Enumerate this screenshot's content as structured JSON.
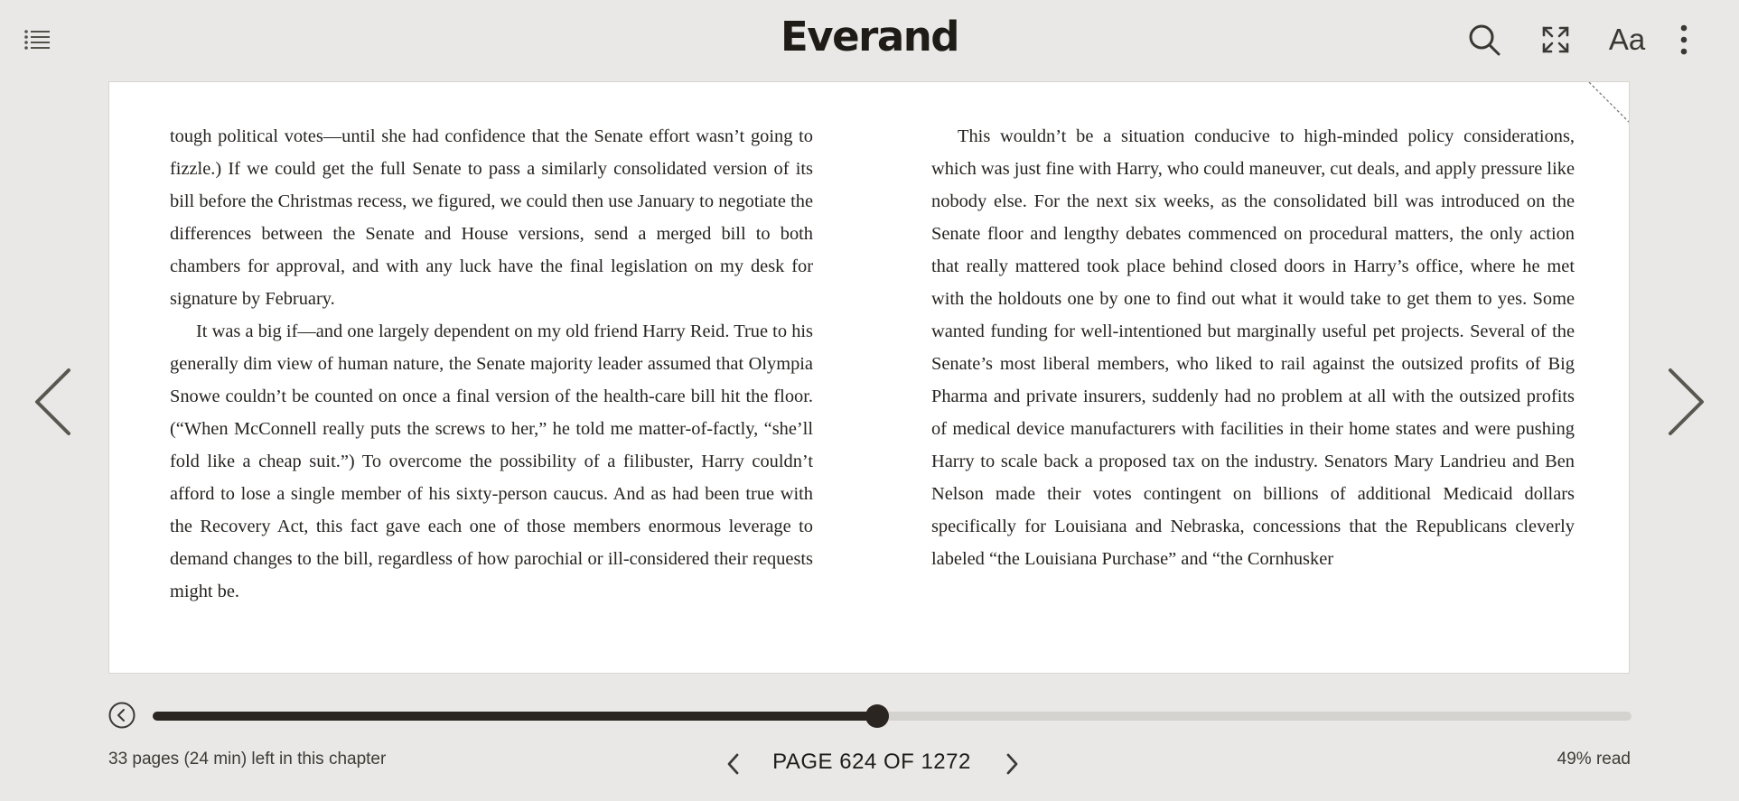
{
  "header": {
    "logo": "Everand",
    "icons": {
      "toc": "list-icon",
      "search": "search-icon",
      "fullscreen": "expand-icon",
      "font_settings_label": "Aa",
      "more": "more-vertical-icon"
    }
  },
  "book": {
    "left_column": [
      "tough political votes—until she had confidence that the Senate effort wasn’t going to fizzle.) If we could get the full Senate to pass a similarly consolidated version of its bill before the Christmas recess, we figured, we could then use January to negotiate the differences between the Senate and House versions, send a merged bill to both chambers for approval, and with any luck have the final legislation on my desk for signature by February.",
      "It was a big if—and one largely dependent on my old friend Harry Reid. True to his generally dim view of human nature, the Senate majority leader assumed that Olympia Snowe couldn’t be counted on once a final version of the health-care bill hit the floor. (“When McConnell really puts the screws to her,” he told me matter-of-factly, “she’ll fold like a cheap suit.”) To overcome the possibility of a filibuster, Harry couldn’t afford to lose a single member of his sixty-person caucus. And as had been true with the Recovery Act, this fact gave each one of those members enormous leverage to demand changes to the bill, regardless of how parochial or ill-considered their requests might be."
    ],
    "right_column": [
      "This wouldn’t be a situation conducive to high-minded policy considerations, which was just fine with Harry, who could maneuver, cut deals, and apply pressure like nobody else. For the next six weeks, as the consolidated bill was introduced on the Senate floor and lengthy debates commenced on procedural matters, the only action that really mattered took place behind closed doors in Harry’s office, where he met with the holdouts one by one to find out what it would take to get them to yes. Some wanted funding for well-intentioned but marginally useful pet projects. Several of the Senate’s most liberal members, who liked to rail against the outsized profits of Big Pharma and private insurers, suddenly had no problem at all with the outsized profits of medical device manufacturers with facilities in their home states and were pushing Harry to scale back a proposed tax on the industry. Senators Mary Landrieu and Ben Nelson made their votes contingent on billions of additional Medicaid dollars specifically for Louisiana and Nebraska, concessions that the Republicans cleverly labeled “the Louisiana Purchase” and “the Cornhusker"
    ]
  },
  "navigation": {
    "prev_icon": "chevron-left-icon",
    "next_icon": "chevron-right-icon"
  },
  "progress": {
    "fraction": 0.49,
    "back_icon": "circle-back-icon"
  },
  "footer": {
    "chapter_remaining": "33 pages (24 min) left in this chapter",
    "page_label": "PAGE 624 OF 1272",
    "percent_read": "49% read"
  },
  "colors": {
    "background": "#e9e8e6",
    "page": "#ffffff",
    "accent": "#2a2520",
    "track": "#d4d3d0"
  }
}
